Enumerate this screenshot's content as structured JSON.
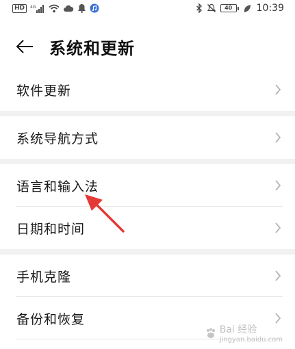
{
  "status_bar": {
    "hd_badge": "HD",
    "network": "4G",
    "battery_level": "40",
    "time": "10:39",
    "icons": [
      "signal-icon",
      "wifi-icon",
      "cloud-icon",
      "notification-icon",
      "music-app-icon",
      "bluetooth-icon",
      "mute-icon",
      "battery-icon",
      "leaf-icon"
    ]
  },
  "header": {
    "title": "系统和更新"
  },
  "menu": {
    "groups": [
      {
        "items": [
          {
            "label": "软件更新"
          }
        ]
      },
      {
        "items": [
          {
            "label": "系统导航方式"
          }
        ]
      },
      {
        "items": [
          {
            "label": "语言和输入法"
          },
          {
            "label": "日期和时间"
          }
        ]
      },
      {
        "items": [
          {
            "label": "手机克隆"
          },
          {
            "label": "备份和恢复"
          }
        ]
      }
    ]
  },
  "annotation": {
    "color": "#e53935"
  },
  "watermark": {
    "text": "Bai 经验",
    "subtext": "jingyan.baidu.com"
  }
}
